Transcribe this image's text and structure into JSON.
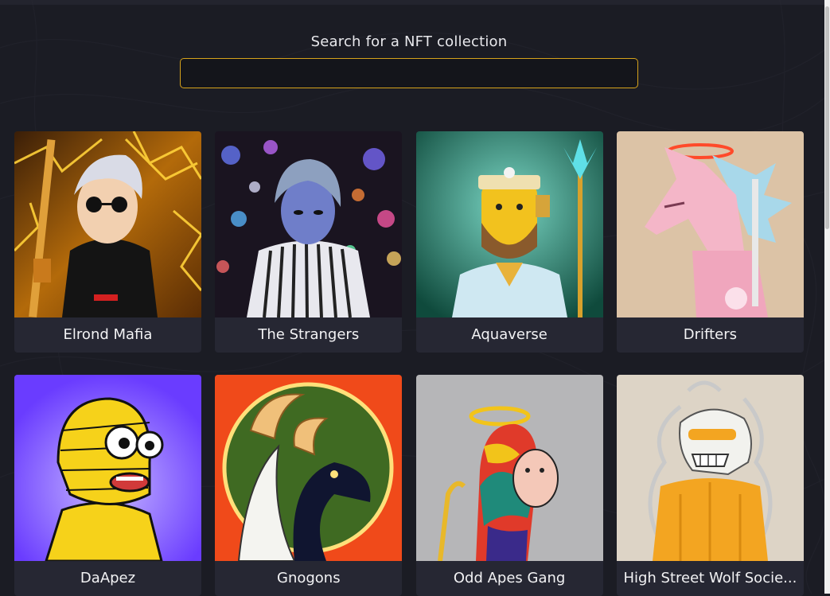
{
  "search": {
    "label": "Search for a NFT collection",
    "value": ""
  },
  "collections": [
    {
      "name": "Elrond Mafia",
      "icon": "elrond-mafia-artwork"
    },
    {
      "name": "The Strangers",
      "icon": "the-strangers-artwork"
    },
    {
      "name": "Aquaverse",
      "icon": "aquaverse-artwork"
    },
    {
      "name": "Drifters",
      "icon": "drifters-artwork"
    },
    {
      "name": "DaApez",
      "icon": "daapez-artwork"
    },
    {
      "name": "Gnogons",
      "icon": "gnogons-artwork"
    },
    {
      "name": "Odd Apes Gang",
      "icon": "odd-apes-gang-artwork"
    },
    {
      "name": "High Street Wolf Socie...",
      "icon": "high-street-wolf-society-artwork"
    }
  ],
  "colors": {
    "accent": "#d6a21b",
    "background": "#1b1c24",
    "card": "#262733"
  }
}
